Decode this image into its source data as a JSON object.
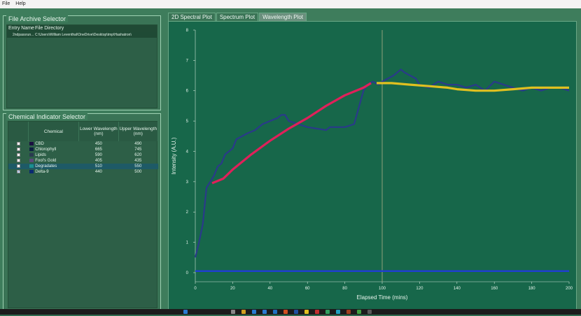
{
  "menu": [
    "File",
    "Help"
  ],
  "file_panel": {
    "title": "File Archive Selector",
    "col_entry": "Entry Name",
    "col_dir": "File Directory",
    "rows": [
      {
        "entry": "2ndpassrun...",
        "dir": "C:\\Users\\William Leventhal\\OneDrive\\Desktop\\tmp\\Hashatron\\"
      }
    ]
  },
  "chem_panel": {
    "title": "Chemical Indicator Selector",
    "headers": {
      "chemical": "Chemical",
      "lower": "Lower Wavelength (nm)",
      "upper": "Upper Wavelength (nm)"
    },
    "rows": [
      {
        "name": "CBD",
        "lower": "450",
        "upper": "490",
        "checked": false,
        "color": "#1a1040"
      },
      {
        "name": "Chlorophyll",
        "lower": "665",
        "upper": "745",
        "checked": false,
        "color": "#0d2040"
      },
      {
        "name": "Lipids",
        "lower": "590",
        "upper": "620",
        "checked": false,
        "color": "#2a3a50"
      },
      {
        "name": "Fool's Gold",
        "lower": "405",
        "upper": "435",
        "checked": false,
        "color": "#5a4a7a"
      },
      {
        "name": "Degradates",
        "lower": "510",
        "upper": "550",
        "checked": false,
        "color": "#1a9090"
      },
      {
        "name": "Delta-9",
        "lower": "440",
        "upper": "500",
        "checked": true,
        "color": "#0a2a70"
      }
    ]
  },
  "tabs": [
    {
      "label": "2D Spectral Plot",
      "active": false
    },
    {
      "label": "Spectrum Plot",
      "active": false
    },
    {
      "label": "Wavelength Plot",
      "active": true
    }
  ],
  "chart_data": {
    "type": "line",
    "xlabel": "Elapsed Time (mins)",
    "ylabel": "Intensity (A.U.)",
    "xlim": [
      0,
      200
    ],
    "ylim": [
      -0.3,
      8
    ],
    "xticks": [
      0,
      20,
      40,
      60,
      80,
      100,
      120,
      140,
      160,
      180,
      200
    ],
    "yticks": [
      0,
      1,
      2,
      3,
      4,
      5,
      6,
      7,
      8
    ],
    "vline_x": 100,
    "series": [
      {
        "color": "#2a3a8a",
        "x": [
          0,
          2,
          4,
          6,
          8,
          10,
          12,
          14,
          16,
          18,
          20,
          22,
          25,
          28,
          32,
          36,
          40,
          44,
          46,
          48,
          50,
          55,
          60,
          65,
          70,
          72,
          75,
          80,
          85,
          90,
          92,
          95,
          98,
          100,
          103,
          106,
          108,
          110,
          112,
          115,
          118,
          120,
          125,
          130,
          135,
          140,
          145,
          150,
          155,
          160,
          165,
          170,
          175,
          180,
          185,
          190,
          195,
          200
        ],
        "y": [
          0.5,
          1.0,
          1.6,
          2.8,
          3.0,
          3.2,
          3.5,
          3.6,
          3.9,
          4.0,
          4.1,
          4.4,
          4.5,
          4.6,
          4.7,
          4.9,
          5.0,
          5.1,
          5.2,
          5.2,
          5.0,
          4.9,
          4.8,
          4.75,
          4.7,
          4.8,
          4.8,
          4.8,
          4.9,
          6.0,
          6.2,
          6.3,
          6.2,
          6.3,
          6.4,
          6.5,
          6.6,
          6.7,
          6.6,
          6.5,
          6.4,
          6.2,
          6.1,
          6.3,
          6.2,
          6.2,
          6.1,
          6.2,
          6.0,
          6.3,
          6.2,
          6.1,
          6.0,
          6.1,
          6.0,
          6.1,
          6.1,
          6.0
        ]
      },
      {
        "color": "#1f3fd0",
        "x": [
          0,
          200
        ],
        "y": [
          0.05,
          0.05
        ]
      },
      {
        "color": "#e0205a",
        "x": [
          9,
          15,
          20,
          30,
          40,
          50,
          60,
          70,
          80,
          90,
          94
        ],
        "y": [
          2.95,
          3.1,
          3.4,
          3.9,
          4.35,
          4.75,
          5.1,
          5.5,
          5.85,
          6.1,
          6.25
        ]
      },
      {
        "color": "#e0c020",
        "x": [
          97,
          105,
          115,
          125,
          135,
          140,
          150,
          160,
          170,
          180,
          190,
          200
        ],
        "y": [
          6.25,
          6.25,
          6.2,
          6.15,
          6.1,
          6.05,
          6.0,
          6.0,
          6.05,
          6.1,
          6.1,
          6.1
        ]
      }
    ]
  },
  "colors": {
    "bg": "#3e7d5c",
    "plot_bg": "#17674a",
    "vline": "#8fa27a"
  }
}
